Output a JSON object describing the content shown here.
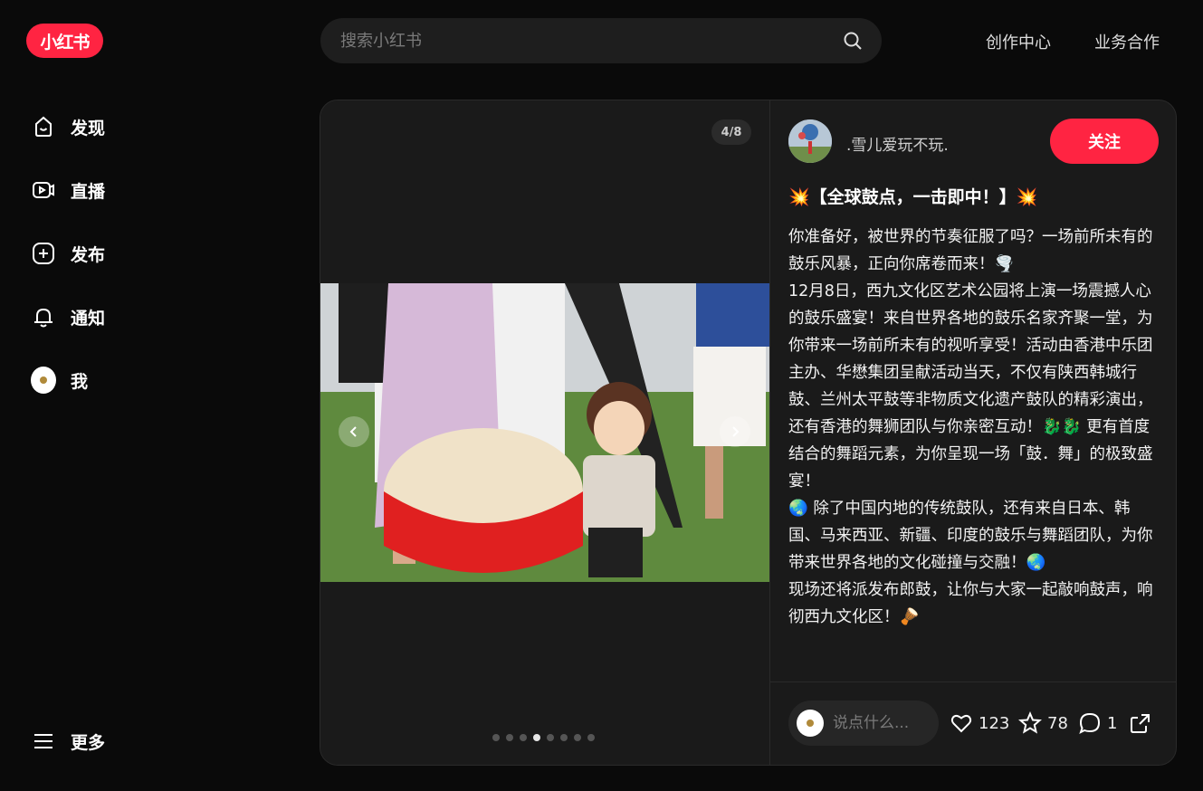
{
  "brand": {
    "logo_text": "小红书",
    "accent": "#ff2442"
  },
  "search": {
    "placeholder": "搜索小红书"
  },
  "top_links": [
    "创作中心",
    "业务合作"
  ],
  "sidebar": {
    "items": [
      {
        "label": "发现",
        "icon": "discover-icon"
      },
      {
        "label": "直播",
        "icon": "live-icon"
      },
      {
        "label": "发布",
        "icon": "publish-plus-icon"
      },
      {
        "label": "通知",
        "icon": "bell-icon"
      },
      {
        "label": "我",
        "icon": "avatar"
      }
    ],
    "more_label": "更多"
  },
  "post": {
    "image_counter": "4/8",
    "image_count": 8,
    "active_image_index": 3,
    "author_name": ".雪儿爱玩不玩.",
    "follow_label": "关注",
    "title": "💥【全球鼓点，一击即中！】💥",
    "description": "你准备好，被世界的节奏征服了吗？一场前所未有的鼓乐风暴，正向你席卷而来！🌪️\n12月8日，西九文化区艺术公园将上演一场震撼人心的鼓乐盛宴！来自世界各地的鼓乐名家齐聚一堂，为你带来一场前所未有的视听享受！活动由香港中乐团主办、华懋集团呈献活动当天，不仅有陕西韩城行鼓、兰州太平鼓等非物质文化遗产鼓队的精彩演出，还有香港的舞狮团队与你亲密互动！🐉🐉 更有首度结合的舞蹈元素，为你呈现一场「鼓．舞」的极致盛宴！\n🌏 除了中国内地的传统鼓队，还有来自日本、韩国、马来西亚、新疆、印度的鼓乐与舞蹈团队，为你带来世界各地的文化碰撞与交融！🌏\n现场还将派发布郎鼓，让你与大家一起敲响鼓声，响彻西九文化区！🪘"
  },
  "engagement": {
    "comment_placeholder": "说点什么...",
    "likes": "123",
    "collects": "78",
    "comments": "1"
  }
}
